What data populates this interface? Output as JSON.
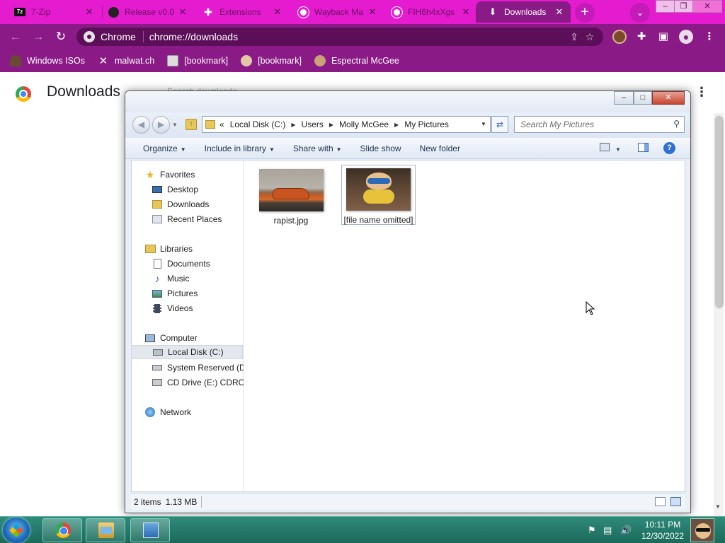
{
  "browser": {
    "tabs": [
      {
        "title": "7-Zip",
        "icon": "seven-zip-icon",
        "active": false
      },
      {
        "title": "Release v0.0",
        "icon": "github-icon",
        "active": false
      },
      {
        "title": "Extensions",
        "icon": "puzzle-icon",
        "active": false
      },
      {
        "title": "Wayback Ma",
        "icon": "globe-icon",
        "active": false
      },
      {
        "title": "FIH6h4xXgs",
        "icon": "globe-icon",
        "active": false
      },
      {
        "title": "Downloads",
        "icon": "download-icon",
        "active": true
      }
    ],
    "tab_close_glyph": "✕",
    "new_tab_glyph": "+",
    "omnibox": {
      "site_label": "Chrome",
      "url": "chrome://downloads"
    },
    "bookmarks": [
      {
        "label": "Windows ISOs",
        "icon": "user-silhouette-icon"
      },
      {
        "label": "malwat.ch",
        "icon": "x-icon"
      },
      {
        "label": "[bookmark]",
        "icon": "page-icon"
      },
      {
        "label": "[bookmark]",
        "icon": "face-icon"
      },
      {
        "label": "Espectral McGee",
        "icon": "face-icon"
      }
    ],
    "colors": {
      "tabstrip": "#e51bd0",
      "toolbar": "#8a1a85"
    }
  },
  "downloads_page": {
    "title": "Downloads",
    "search_placeholder": "Search downloads",
    "menu_glyph": "⋮"
  },
  "explorer": {
    "window_title": "My Pictures",
    "breadcrumb": [
      "«",
      "Local Disk (C:)",
      "Users",
      "Molly McGee",
      "My Pictures"
    ],
    "search_placeholder": "Search My Pictures",
    "commands": [
      "Organize",
      "Include in library",
      "Share with",
      "Slide show",
      "New folder"
    ],
    "nav": {
      "favorites": {
        "label": "Favorites",
        "items": [
          "Desktop",
          "Downloads",
          "Recent Places"
        ]
      },
      "libraries": {
        "label": "Libraries",
        "items": [
          "Documents",
          "Music",
          "Pictures",
          "Videos"
        ]
      },
      "computer": {
        "label": "Computer",
        "items": [
          "Local Disk (C:)",
          "System Reserved (D:)",
          "CD Drive (E:) CDROM"
        ]
      },
      "network": {
        "label": "Network"
      }
    },
    "selected_nav": "Local Disk (C:)",
    "files": [
      {
        "name": "rapist.jpg",
        "selected": false
      },
      {
        "name": "[file name omitted]",
        "selected": true
      }
    ],
    "status": {
      "count": "2 items",
      "size": "1.13 MB"
    }
  },
  "taskbar": {
    "apps": [
      "start-orb",
      "chrome",
      "windows-explorer",
      "control-panel"
    ],
    "clock": {
      "time": "10:11 PM",
      "date": "12/30/2022"
    }
  }
}
